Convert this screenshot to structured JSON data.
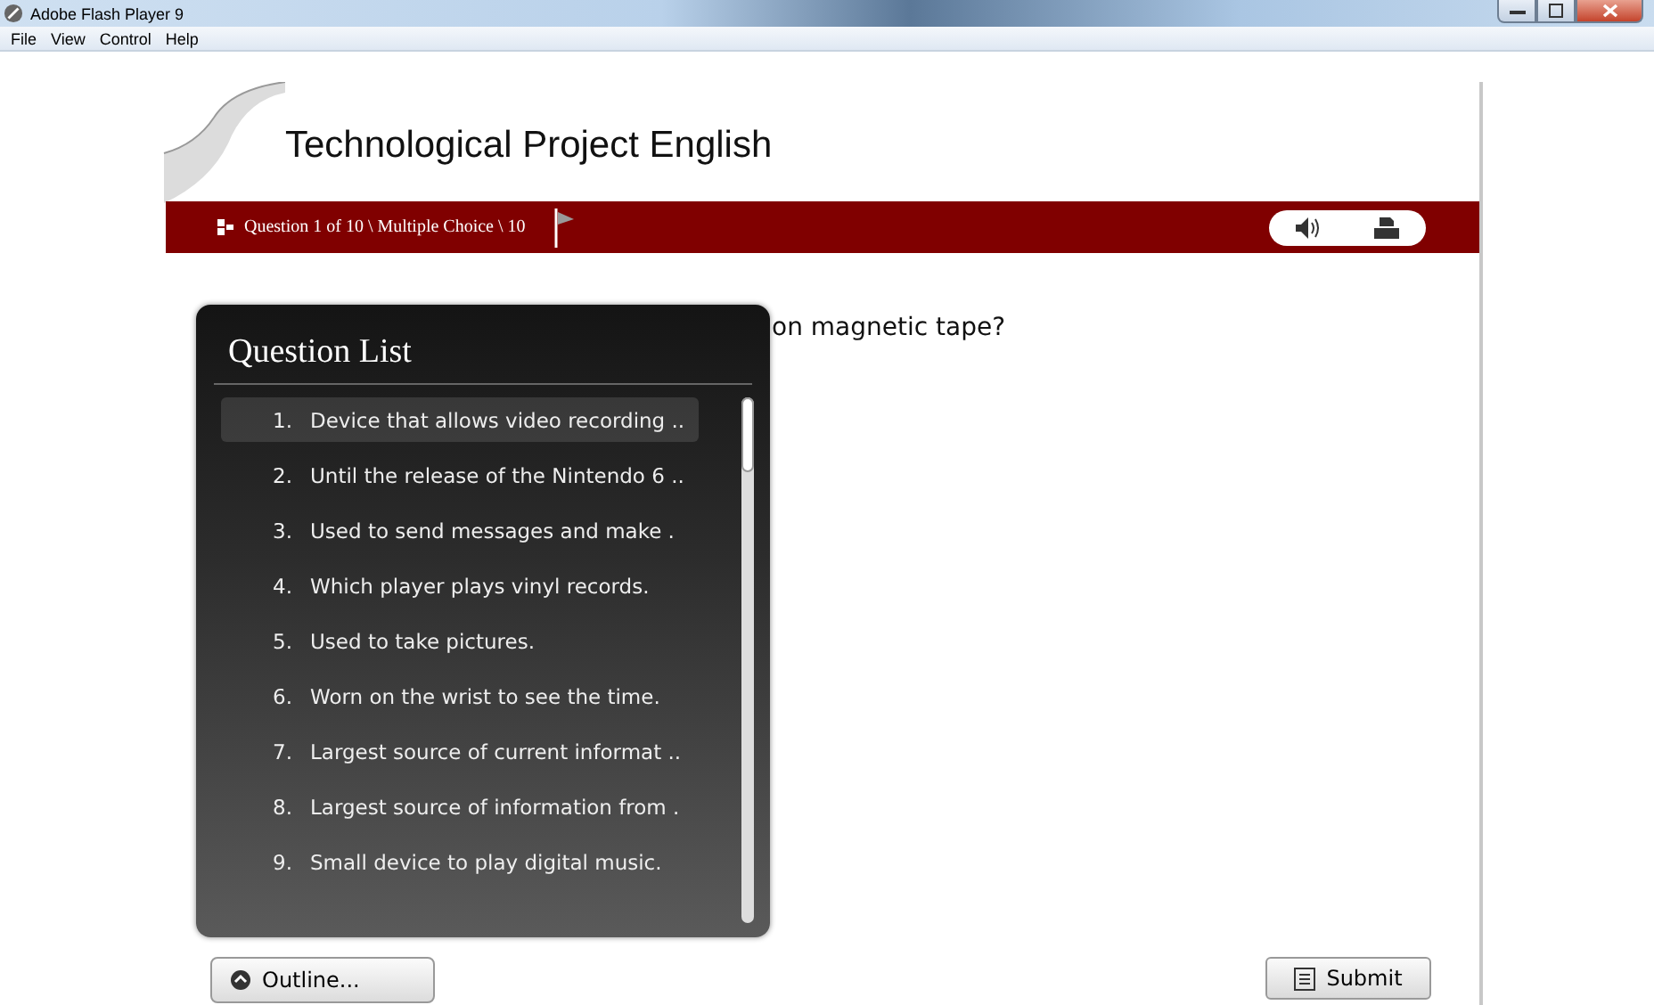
{
  "window": {
    "title": "Adobe Flash Player 9"
  },
  "menu": [
    "File",
    "View",
    "Control",
    "Help"
  ],
  "quiz": {
    "title": "Technological Project English",
    "status": "Question 1 of 10 \\ Multiple Choice \\ 10",
    "question_visible": "on magnetic tape?",
    "question_list": {
      "title": "Question List",
      "items": [
        {
          "number": "1.",
          "text": "Device that allows video recording ..",
          "selected": true
        },
        {
          "number": "2.",
          "text": "Until the release of the Nintendo 6 ..",
          "selected": false
        },
        {
          "number": "3.",
          "text": "Used to send messages and make .",
          "selected": false
        },
        {
          "number": "4.",
          "text": "Which player plays vinyl records.",
          "selected": false
        },
        {
          "number": "5.",
          "text": "Used to take pictures.",
          "selected": false
        },
        {
          "number": "6.",
          "text": "Worn on the wrist to see the time.",
          "selected": false
        },
        {
          "number": "7.",
          "text": "Largest source of current informat ..",
          "selected": false
        },
        {
          "number": "8.",
          "text": "Largest source of information from .",
          "selected": false
        },
        {
          "number": "9.",
          "text": "Small device to play digital music.",
          "selected": false
        }
      ]
    },
    "outline_button": "Outline...",
    "submit_button": "Submit"
  }
}
